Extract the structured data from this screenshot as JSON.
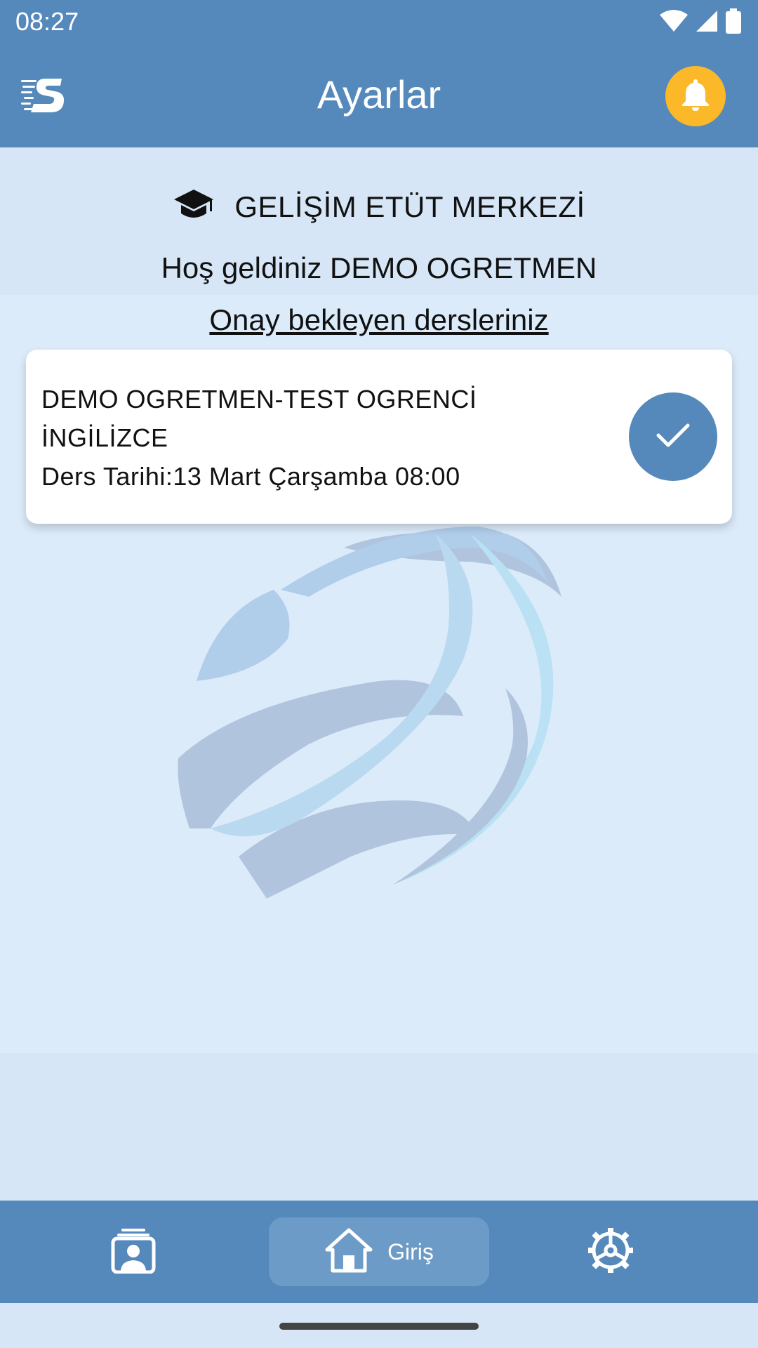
{
  "status_bar": {
    "time": "08:27",
    "icons": [
      "wifi-icon",
      "cellular-signal-icon",
      "battery-icon"
    ]
  },
  "app_bar": {
    "title": "Ayarlar",
    "logo_icon": "app-logo-s",
    "notification_icon": "bell-icon",
    "notification_color": "#fbb829"
  },
  "header": {
    "institution_icon": "graduation-cap-icon",
    "institution_name": "GELİŞİM ETÜT MERKEZİ",
    "welcome_text": "Hoş geldiniz DEMO OGRETMEN"
  },
  "main": {
    "pending_link": "Onay bekleyen dersleriniz",
    "lessons": [
      {
        "participants": "DEMO OGRETMEN-TEST OGRENCİ",
        "subject": "İNGİLİZCE",
        "date": "Ders Tarihi:13 Mart Çarşamba 08:00",
        "action_icon": "check-icon"
      }
    ],
    "background_icon": "globe-icon"
  },
  "bottom_nav": {
    "items": [
      {
        "icon": "profile-icon",
        "label": ""
      },
      {
        "icon": "home-icon",
        "label": "Giriş",
        "active": true
      },
      {
        "icon": "settings-icon",
        "label": ""
      }
    ]
  },
  "colors": {
    "primary": "#5589bb",
    "background": "#dcebfa",
    "accent": "#fbb829"
  }
}
